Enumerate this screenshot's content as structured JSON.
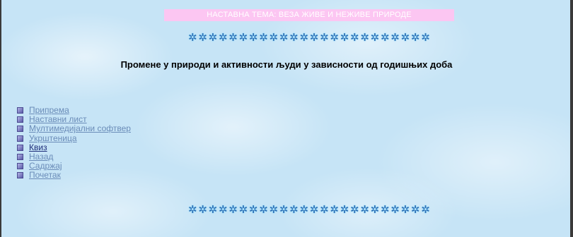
{
  "banner": {
    "text": "НАСТАВНА ТЕМА: ВЕЗА ЖИВЕ И НЕЖИВЕ ПРИРОДЕ"
  },
  "stars_glyph": "✲",
  "stars_count": 24,
  "heading": "Промене у природи и активности људи у зависности од годишњих доба",
  "nav": {
    "items": [
      {
        "label": "Припрема",
        "active": false
      },
      {
        "label": "Наставни лист",
        "active": false
      },
      {
        "label": "Мултимедијални софтвер",
        "active": false
      },
      {
        "label": "Укрштеница",
        "active": false
      },
      {
        "label": "Квиз",
        "active": true
      },
      {
        "label": "Назад",
        "active": false
      },
      {
        "label": "Садржај",
        "active": false
      },
      {
        "label": "Почетак",
        "active": false
      }
    ]
  },
  "colors": {
    "background": "#c6e4f6",
    "banner_bg": "#fcc6f2",
    "link": "#6a8cb8",
    "link_active": "#1e2e7a",
    "stars": "#2f6fb4"
  }
}
